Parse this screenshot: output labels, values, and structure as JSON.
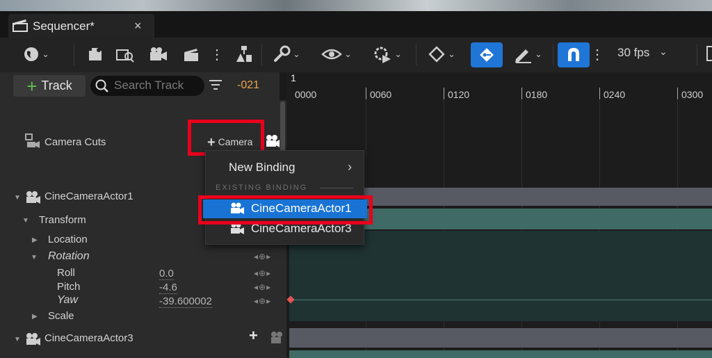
{
  "tab": {
    "title": "Sequencer*",
    "close": "×"
  },
  "toolbar": {
    "fps": "30 fps"
  },
  "left": {
    "track_label": "Track",
    "search_placeholder": "Search Track",
    "frame": "-021"
  },
  "ruler": {
    "top_marker": "1",
    "labels": [
      "0000",
      "0060",
      "0120",
      "0180",
      "0240",
      "0300"
    ]
  },
  "tracks": {
    "camera_cuts": "Camera Cuts",
    "camera_button": "Camera",
    "actor1": "CineCameraActor1",
    "transform": "Transform",
    "location": "Location",
    "rotation": "Rotation",
    "roll": "Roll",
    "roll_value": "0.0",
    "pitch": "Pitch",
    "pitch_value": "-4.6",
    "yaw": "Yaw",
    "yaw_value": "-39.600002",
    "scale": "Scale",
    "actor3": "CineCameraActor3"
  },
  "menu": {
    "new_binding": "New Binding",
    "existing_header": "EXISTING BINDING",
    "items": [
      "CineCameraActor1",
      "CineCameraActor3"
    ]
  },
  "colors": {
    "accent": "#1873d4",
    "highlight_box": "#e8001c",
    "frame": "#e9a64a"
  }
}
